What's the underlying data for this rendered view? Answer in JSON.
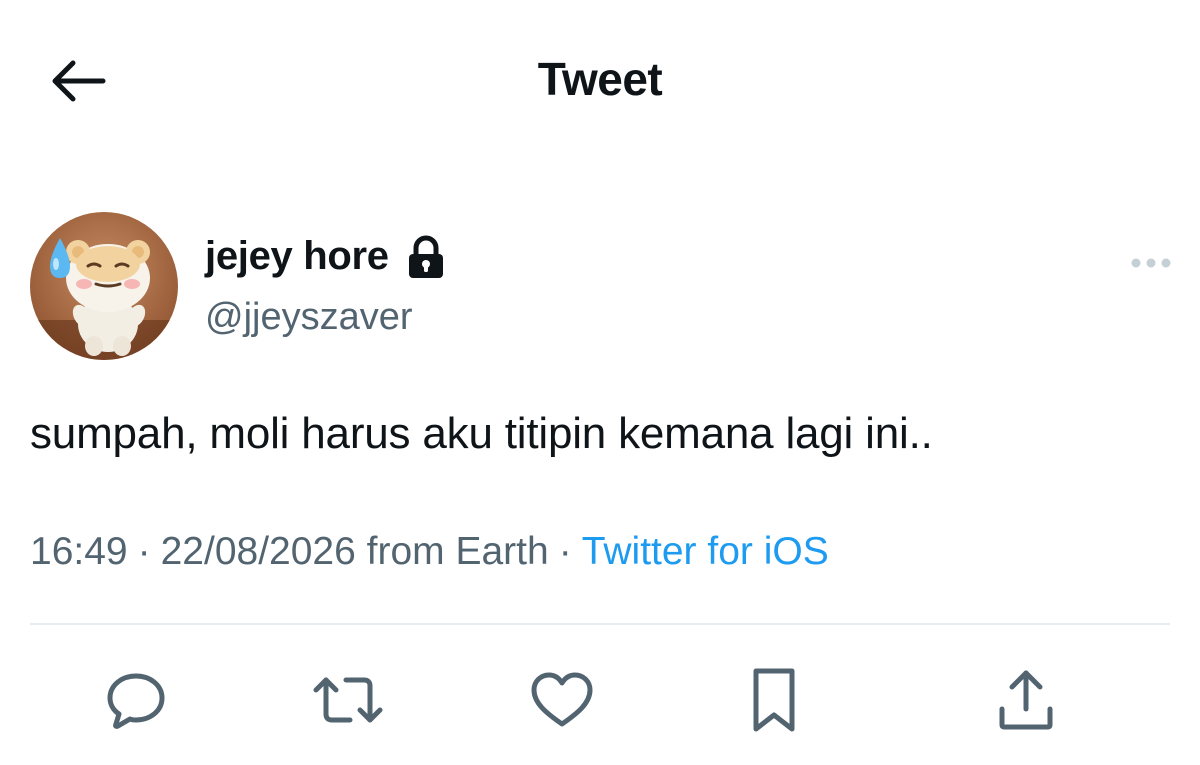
{
  "header": {
    "title": "Tweet",
    "back_icon": "arrow-left-icon"
  },
  "tweet": {
    "author": {
      "display_name": "jejey hore",
      "username": "@jjeyszaver",
      "protected": true,
      "lock_icon": "lock-icon",
      "avatar_icon": "bear-mascot-avatar"
    },
    "more_icon": "more-horizontal-icon",
    "text": "sumpah, moli harus aku titipin kemana lagi ini..",
    "meta": {
      "time": "16:49",
      "separator": "·",
      "date_location": "22/08/2026 from Earth",
      "source": "Twitter for iOS"
    }
  },
  "actions": [
    {
      "name": "reply",
      "icon": "reply-icon"
    },
    {
      "name": "retweet",
      "icon": "retweet-icon"
    },
    {
      "name": "like",
      "icon": "heart-icon"
    },
    {
      "name": "bookmark",
      "icon": "bookmark-icon"
    },
    {
      "name": "share",
      "icon": "share-icon"
    }
  ],
  "colors": {
    "text_primary": "#0f1419",
    "text_secondary": "#536471",
    "accent": "#1d9bf0",
    "divider": "#e6ecf0"
  }
}
